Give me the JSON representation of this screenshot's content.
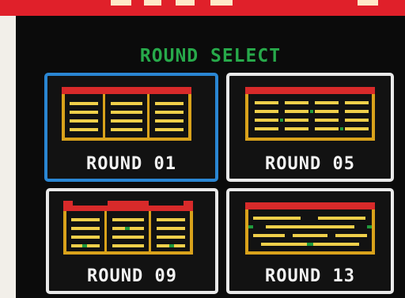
{
  "screen": {
    "title": "ROUND SELECT",
    "rounds": [
      {
        "label": "ROUND 01",
        "selected": true
      },
      {
        "label": "ROUND 05",
        "selected": false
      },
      {
        "label": "ROUND 09",
        "selected": false
      },
      {
        "label": "ROUND 13",
        "selected": false
      }
    ]
  },
  "colors": {
    "title": "#27a94a",
    "selected_border": "#2a86d3",
    "card_border": "#e9e9e9",
    "roof": "#d82a2a",
    "post": "#d9a21b",
    "bar": "#f0cf4a",
    "accent": "#1f9a3c",
    "banner": "#e0202a"
  }
}
